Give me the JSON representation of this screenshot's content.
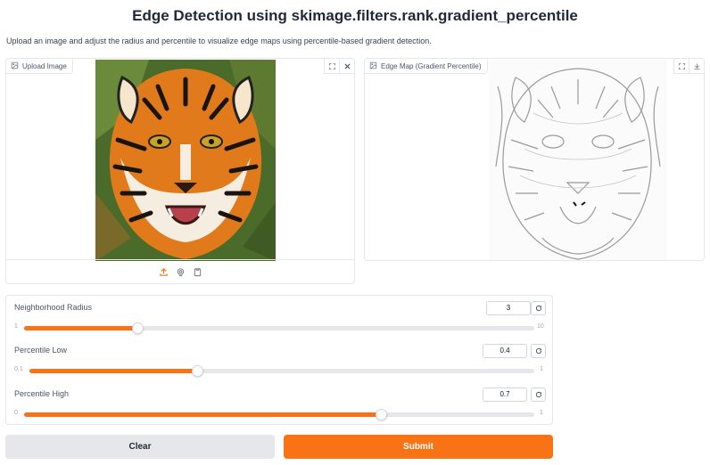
{
  "header": {
    "title": "Edge Detection using skimage.filters.rank.gradient_percentile",
    "description": "Upload an image and adjust the radius and percentile to visualize edge maps using percentile-based gradient detection."
  },
  "input_panel": {
    "label": "Upload Image",
    "label_icon": "image-icon",
    "tools": [
      "fullscreen-icon",
      "close-icon"
    ],
    "sources": [
      "upload-icon",
      "webcam-icon",
      "clipboard-icon"
    ]
  },
  "output_panel": {
    "label": "Edge Map (Gradient Percentile)",
    "label_icon": "image-icon",
    "tools": [
      "fullscreen-icon",
      "download-icon"
    ]
  },
  "sliders": [
    {
      "label": "Neighborhood Radius",
      "value": "3",
      "min": "1",
      "max": "10",
      "fill_fraction": 0.222
    },
    {
      "label": "Percentile Low",
      "value": "0.4",
      "min": "0.1",
      "max": "1",
      "fill_fraction": 0.333
    },
    {
      "label": "Percentile High",
      "value": "0.7",
      "min": "0",
      "max": "1",
      "fill_fraction": 0.7
    }
  ],
  "buttons": {
    "clear": "Clear",
    "submit": "Submit"
  },
  "colors": {
    "accent": "#f97316",
    "track": "#e5e7eb",
    "clear_bg": "#e5e7eb"
  }
}
